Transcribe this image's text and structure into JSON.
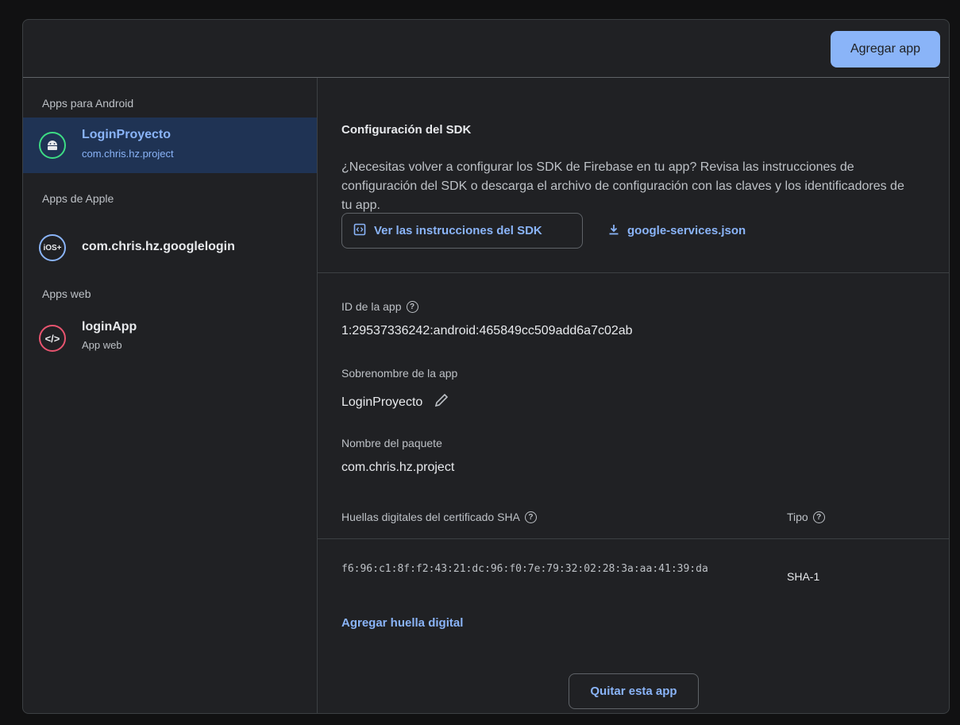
{
  "header": {
    "add_app_label": "Agregar app"
  },
  "sidebar": {
    "sections": [
      {
        "label": "Apps para Android",
        "apps": [
          {
            "title": "LoginProyecto",
            "subtitle": "com.chris.hz.project",
            "icon": "android-icon",
            "selected": true
          }
        ]
      },
      {
        "label": "Apps de Apple",
        "apps": [
          {
            "title": "com.chris.hz.googlelogin",
            "icon": "ios-icon",
            "icon_text": "iOS+"
          }
        ]
      },
      {
        "label": "Apps web",
        "apps": [
          {
            "title": "loginApp",
            "subtitle": "App web",
            "icon": "code-icon",
            "icon_text": "</>"
          }
        ]
      }
    ]
  },
  "sdk": {
    "heading": "Configuración del SDK",
    "description": "¿Necesitas volver a configurar los SDK de Firebase en tu app? Revisa las instrucciones de configuración del SDK o descarga el archivo de configuración con las claves y los identificadores de tu app.",
    "instructions_button": "Ver las instrucciones del SDK",
    "download_link": "google-services.json"
  },
  "details": {
    "app_id_label": "ID de la app",
    "app_id_value": "1:29537336242:android:465849cc509add6a7c02ab",
    "nickname_label": "Sobrenombre de la app",
    "nickname_value": "LoginProyecto",
    "package_label": "Nombre del paquete",
    "package_value": "com.chris.hz.project"
  },
  "sha": {
    "col_fingerprint": "Huellas digitales del certificado SHA",
    "col_type": "Tipo",
    "rows": [
      {
        "fingerprint": "f6:96:c1:8f:f2:43:21:dc:96:f0:7e:79:32:02:28:3a:aa:41:39:da",
        "type": "SHA-1"
      }
    ],
    "add_label": "Agregar huella digital"
  },
  "remove_label": "Quitar esta app",
  "colors": {
    "accent": "#8ab4f8",
    "selected_bg": "#1f3354",
    "android": "#3ddc84",
    "ios": "#8ab4f8",
    "web": "#e8546f"
  }
}
